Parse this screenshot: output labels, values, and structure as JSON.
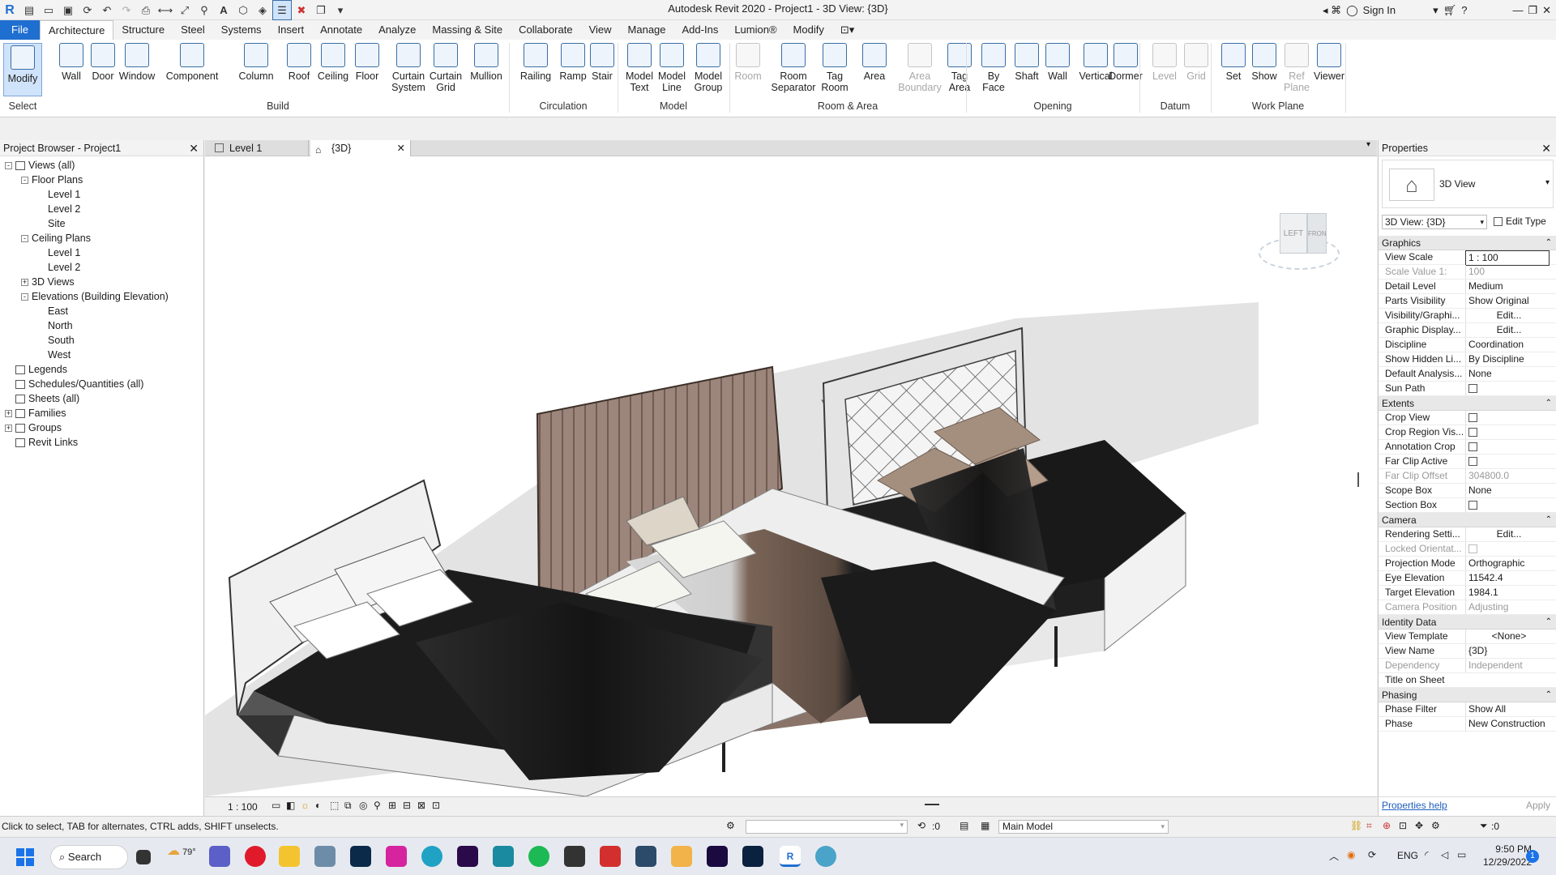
{
  "app": {
    "title": "Autodesk Revit 2020 - Project1 - 3D View: {3D}",
    "sign_in": "Sign In"
  },
  "tabs": [
    "File",
    "Architecture",
    "Structure",
    "Steel",
    "Systems",
    "Insert",
    "Annotate",
    "Analyze",
    "Massing & Site",
    "Collaborate",
    "View",
    "Manage",
    "Add-Ins",
    "Lumion®",
    "Modify"
  ],
  "active_tab": "Architecture",
  "ribbon": {
    "select_label": "Select",
    "buttons": [
      {
        "label": "Modify",
        "icon": "cursor-icon",
        "enabled": true
      },
      {
        "label": "Wall",
        "icon": "wall-icon",
        "enabled": true
      },
      {
        "label": "Door",
        "icon": "door-icon",
        "enabled": true
      },
      {
        "label": "Window",
        "icon": "window-icon",
        "enabled": true
      },
      {
        "label": "Component",
        "icon": "component-icon",
        "enabled": true
      },
      {
        "label": "Column",
        "icon": "column-icon",
        "enabled": true
      },
      {
        "label": "Roof",
        "icon": "roof-icon",
        "enabled": true
      },
      {
        "label": "Ceiling",
        "icon": "ceiling-icon",
        "enabled": true
      },
      {
        "label": "Floor",
        "icon": "floor-icon",
        "enabled": true
      },
      {
        "label": "Curtain\nSystem",
        "icon": "curtain-system-icon",
        "enabled": true
      },
      {
        "label": "Curtain\nGrid",
        "icon": "curtain-grid-icon",
        "enabled": true
      },
      {
        "label": "Mullion",
        "icon": "mullion-icon",
        "enabled": true
      },
      {
        "label": "Railing",
        "icon": "railing-icon",
        "enabled": true
      },
      {
        "label": "Ramp",
        "icon": "ramp-icon",
        "enabled": true
      },
      {
        "label": "Stair",
        "icon": "stair-icon",
        "enabled": true
      },
      {
        "label": "Model\nText",
        "icon": "model-text-icon",
        "enabled": true
      },
      {
        "label": "Model\nLine",
        "icon": "model-line-icon",
        "enabled": true
      },
      {
        "label": "Model\nGroup",
        "icon": "model-group-icon",
        "enabled": true
      },
      {
        "label": "Room",
        "icon": "room-icon",
        "enabled": false
      },
      {
        "label": "Room\nSeparator",
        "icon": "room-separator-icon",
        "enabled": true
      },
      {
        "label": "Tag\nRoom",
        "icon": "tag-room-icon",
        "enabled": true
      },
      {
        "label": "Area",
        "icon": "area-icon",
        "enabled": true
      },
      {
        "label": "Area\nBoundary",
        "icon": "area-boundary-icon",
        "enabled": false
      },
      {
        "label": "Tag\nArea",
        "icon": "tag-area-icon",
        "enabled": true
      },
      {
        "label": "By\nFace",
        "icon": "by-face-icon",
        "enabled": true
      },
      {
        "label": "Shaft",
        "icon": "shaft-icon",
        "enabled": true
      },
      {
        "label": "Wall",
        "icon": "wall-opening-icon",
        "enabled": true
      },
      {
        "label": "Vertical",
        "icon": "vertical-icon",
        "enabled": true
      },
      {
        "label": "Dormer",
        "icon": "dormer-icon",
        "enabled": true
      },
      {
        "label": "Level",
        "icon": "level-icon",
        "enabled": false
      },
      {
        "label": "Grid",
        "icon": "grid-icon",
        "enabled": false
      },
      {
        "label": "Set",
        "icon": "set-icon",
        "enabled": true
      },
      {
        "label": "Show",
        "icon": "show-icon",
        "enabled": true
      },
      {
        "label": "Ref\nPlane",
        "icon": "ref-plane-icon",
        "enabled": false
      },
      {
        "label": "Viewer",
        "icon": "viewer-icon",
        "enabled": true
      }
    ],
    "panels": [
      "Build",
      "Circulation",
      "Model",
      "Room & Area",
      "Opening",
      "Datum",
      "Work Plane"
    ]
  },
  "browser": {
    "title": "Project Browser - Project1",
    "rows": [
      {
        "label": "Views (all)",
        "indent": 0,
        "toggle": "-"
      },
      {
        "label": "Floor Plans",
        "indent": 1,
        "toggle": "-"
      },
      {
        "label": "Level 1",
        "indent": 2,
        "toggle": ""
      },
      {
        "label": "Level 2",
        "indent": 2,
        "toggle": ""
      },
      {
        "label": "Site",
        "indent": 2,
        "toggle": ""
      },
      {
        "label": "Ceiling Plans",
        "indent": 1,
        "toggle": "-"
      },
      {
        "label": "Level 1",
        "indent": 2,
        "toggle": ""
      },
      {
        "label": "Level 2",
        "indent": 2,
        "toggle": ""
      },
      {
        "label": "3D Views",
        "indent": 1,
        "toggle": "+"
      },
      {
        "label": "Elevations (Building Elevation)",
        "indent": 1,
        "toggle": "-"
      },
      {
        "label": "East",
        "indent": 2,
        "toggle": ""
      },
      {
        "label": "North",
        "indent": 2,
        "toggle": ""
      },
      {
        "label": "South",
        "indent": 2,
        "toggle": ""
      },
      {
        "label": "West",
        "indent": 2,
        "toggle": ""
      },
      {
        "label": "Legends",
        "indent": 0,
        "toggle": "",
        "icon": true
      },
      {
        "label": "Schedules/Quantities (all)",
        "indent": 0,
        "toggle": "",
        "icon": true
      },
      {
        "label": "Sheets (all)",
        "indent": 0,
        "toggle": "",
        "icon": true
      },
      {
        "label": "Families",
        "indent": 0,
        "toggle": "+",
        "icon": true
      },
      {
        "label": "Groups",
        "indent": 0,
        "toggle": "+",
        "icon": true
      },
      {
        "label": "Revit Links",
        "indent": 0,
        "toggle": "",
        "icon": true
      }
    ]
  },
  "view_tabs": [
    {
      "label": "Level 1",
      "active": false
    },
    {
      "label": "{3D}",
      "active": true
    }
  ],
  "viewcube": {
    "left": "LEFT",
    "front": "FRONT"
  },
  "view_bar": {
    "scale": "1 : 100"
  },
  "properties": {
    "title": "Properties",
    "type_name": "3D View",
    "selector": "3D View: {3D}",
    "edit_type": "Edit Type",
    "sections": [
      {
        "name": "Graphics",
        "rows": [
          {
            "k": "View Scale",
            "v": "1 : 100",
            "dis": false,
            "kind": "input"
          },
          {
            "k": "Scale Value    1:",
            "v": "100",
            "dis": true
          },
          {
            "k": "Detail Level",
            "v": "Medium",
            "dis": false
          },
          {
            "k": "Parts Visibility",
            "v": "Show Original",
            "dis": false
          },
          {
            "k": "Visibility/Graphi...",
            "v": "Edit...",
            "dis": false,
            "kind": "btn"
          },
          {
            "k": "Graphic Display...",
            "v": "Edit...",
            "dis": false,
            "kind": "btn"
          },
          {
            "k": "Discipline",
            "v": "Coordination",
            "dis": false
          },
          {
            "k": "Show Hidden Li...",
            "v": "By Discipline",
            "dis": false
          },
          {
            "k": "Default Analysis...",
            "v": "None",
            "dis": false
          },
          {
            "k": "Sun Path",
            "v": "",
            "dis": false,
            "kind": "chk"
          }
        ]
      },
      {
        "name": "Extents",
        "rows": [
          {
            "k": "Crop View",
            "v": "",
            "dis": false,
            "kind": "chk"
          },
          {
            "k": "Crop Region Vis...",
            "v": "",
            "dis": false,
            "kind": "chk"
          },
          {
            "k": "Annotation Crop",
            "v": "",
            "dis": false,
            "kind": "chk"
          },
          {
            "k": "Far Clip Active",
            "v": "",
            "dis": false,
            "kind": "chk"
          },
          {
            "k": "Far Clip Offset",
            "v": "304800.0",
            "dis": true
          },
          {
            "k": "Scope Box",
            "v": "None",
            "dis": false
          },
          {
            "k": "Section Box",
            "v": "",
            "dis": false,
            "kind": "chk"
          }
        ]
      },
      {
        "name": "Camera",
        "rows": [
          {
            "k": "Rendering Setti...",
            "v": "Edit...",
            "dis": false,
            "kind": "btn"
          },
          {
            "k": "Locked Orientat...",
            "v": "",
            "dis": true,
            "kind": "chk"
          },
          {
            "k": "Projection Mode",
            "v": "Orthographic",
            "dis": false
          },
          {
            "k": "Eye Elevation",
            "v": "11542.4",
            "dis": false
          },
          {
            "k": "Target Elevation",
            "v": "1984.1",
            "dis": false
          },
          {
            "k": "Camera Position",
            "v": "Adjusting",
            "dis": true
          }
        ]
      },
      {
        "name": "Identity Data",
        "rows": [
          {
            "k": "View Template",
            "v": "<None>",
            "dis": false,
            "kind": "btn"
          },
          {
            "k": "View Name",
            "v": "{3D}",
            "dis": false
          },
          {
            "k": "Dependency",
            "v": "Independent",
            "dis": true
          },
          {
            "k": "Title on Sheet",
            "v": "",
            "dis": false
          }
        ]
      },
      {
        "name": "Phasing",
        "rows": [
          {
            "k": "Phase Filter",
            "v": "Show All",
            "dis": false
          },
          {
            "k": "Phase",
            "v": "New Construction",
            "dis": false
          }
        ]
      }
    ],
    "help_link": "Properties help",
    "apply": "Apply"
  },
  "status": {
    "hint": "Click to select, TAB for alternates, CTRL adds, SHIFT unselects.",
    "count": ":0",
    "model": "Main Model",
    "filter": ":0"
  },
  "taskbar": {
    "search": "Search",
    "weather": "79°",
    "lang": "ENG",
    "time": "9:50 PM",
    "date": "12/29/2022",
    "notifications": "1"
  },
  "colors": {
    "accent": "#1f6fd1",
    "selection": "#cfe3fa"
  }
}
